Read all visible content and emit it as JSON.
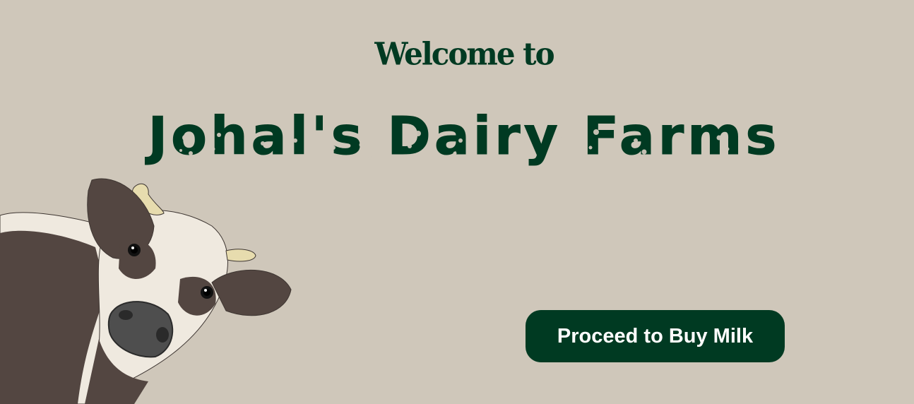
{
  "hero": {
    "welcome_text": "Welcome to",
    "title_text": "Johal's Dairy Farms",
    "cta_label": "Proceed to Buy Milk"
  },
  "colors": {
    "background": "#cfc7ba",
    "brand_green": "#003a22",
    "button_text": "#ffffff"
  },
  "illustration": {
    "icon": "cow-illustration"
  }
}
